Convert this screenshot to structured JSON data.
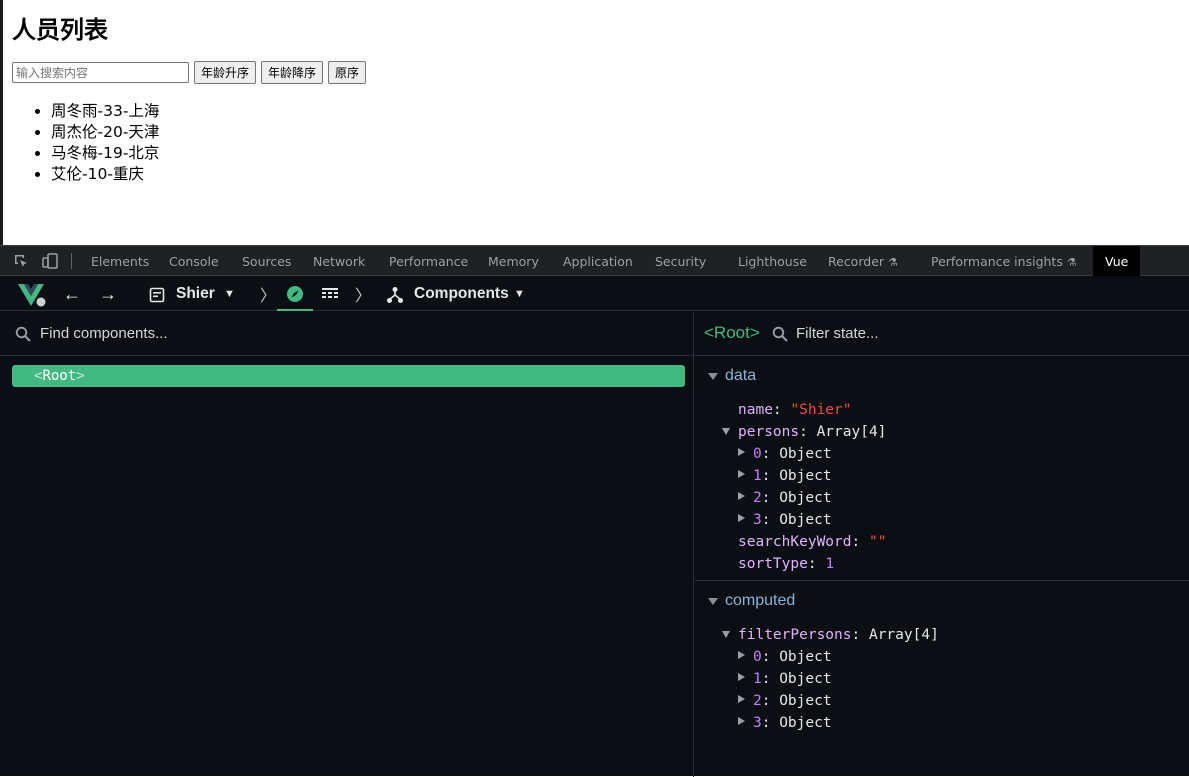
{
  "page": {
    "title": "人员列表",
    "search_placeholder": "输入搜索内容",
    "buttons": [
      "年龄升序",
      "年龄降序",
      "原序"
    ],
    "persons": [
      "周冬雨-33-上海",
      "周杰伦-20-天津",
      "马冬梅-19-北京",
      "艾伦-10-重庆"
    ]
  },
  "devtools": {
    "tabs": [
      "Elements",
      "Console",
      "Sources",
      "Network",
      "Performance",
      "Memory",
      "Application",
      "Security",
      "Lighthouse",
      "Recorder",
      "Performance insights",
      "Vue"
    ],
    "active_tab": "Vue",
    "vue": {
      "app_name": "Shier",
      "view": "Components",
      "find_placeholder": "Find components...",
      "root_component": "Root",
      "filter_placeholder": "Filter state...",
      "selected_tag": "<Root>",
      "data_section": "data",
      "computed_section": "computed",
      "data": {
        "name_key": "name",
        "name_val": "\"Shier\"",
        "persons_key": "persons",
        "persons_val": "Array[4]",
        "items": [
          "0",
          "1",
          "2",
          "3"
        ],
        "item_type": "Object",
        "search_key": "searchKeyWord",
        "search_val": "\"\"",
        "sort_key": "sortType",
        "sort_val": "1"
      },
      "computed": {
        "filter_key": "filterPersons",
        "filter_val": "Array[4]",
        "items": [
          "0",
          "1",
          "2",
          "3"
        ],
        "item_type": "Object"
      }
    }
  },
  "colors": {
    "vue_green": "#42b883",
    "devtools_bg": "#0b0f13",
    "key": "#e1b3ff",
    "string": "#f14c4c"
  }
}
